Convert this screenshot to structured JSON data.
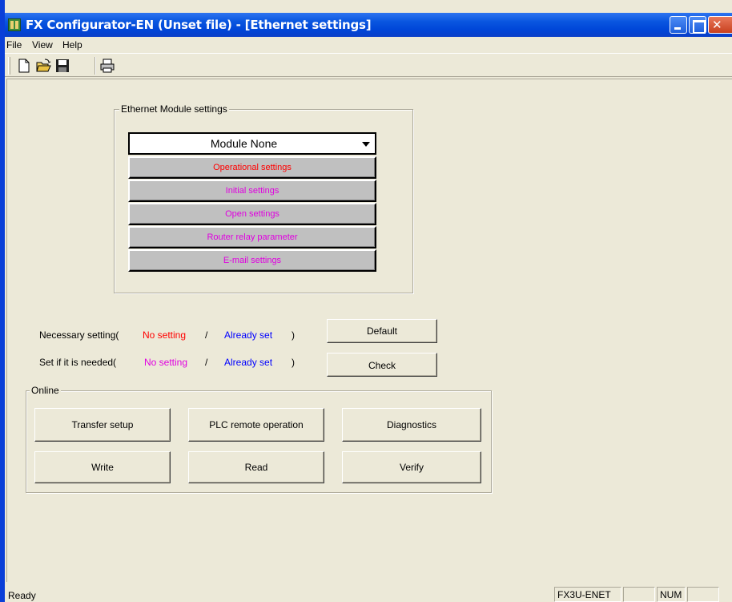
{
  "window": {
    "title": "FX Configurator-EN (Unset file) - [Ethernet settings]"
  },
  "menu": {
    "items": [
      "File",
      "View",
      "Help"
    ]
  },
  "toolbar": {
    "buttons": [
      "new-file-icon",
      "open-folder-icon",
      "save-disk-icon",
      "print-icon"
    ]
  },
  "ethernet_module": {
    "group_label": "Ethernet Module settings",
    "selected_module": "Module None",
    "buttons": [
      {
        "label": "Operational settings",
        "color": "#FF0000"
      },
      {
        "label": "Initial settings",
        "color": "#E000E0"
      },
      {
        "label": "Open settings",
        "color": "#E000E0"
      },
      {
        "label": "Router relay parameter",
        "color": "#E000E0"
      },
      {
        "label": "E-mail settings",
        "color": "#E000E0"
      }
    ]
  },
  "legend": {
    "necessary_prefix": "Necessary setting(",
    "needed_prefix": "Set if it is needed(",
    "no_setting": "No setting",
    "slash": "/",
    "already_set": "Already set",
    "close_paren": ")",
    "necessary_color": "#FF0000",
    "needed_color": "#E000E0",
    "set_color": "#0000FF"
  },
  "actions": {
    "default_label": "Default",
    "check_label": "Check"
  },
  "online": {
    "group_label": "Online",
    "transfer_setup": "Transfer setup",
    "plc_remote_operation": "PLC remote operation",
    "diagnostics": "Diagnostics",
    "write": "Write",
    "read": "Read",
    "verify": "Verify"
  },
  "status": {
    "ready": "Ready",
    "module": "FX3U-ENET",
    "num": "NUM"
  }
}
